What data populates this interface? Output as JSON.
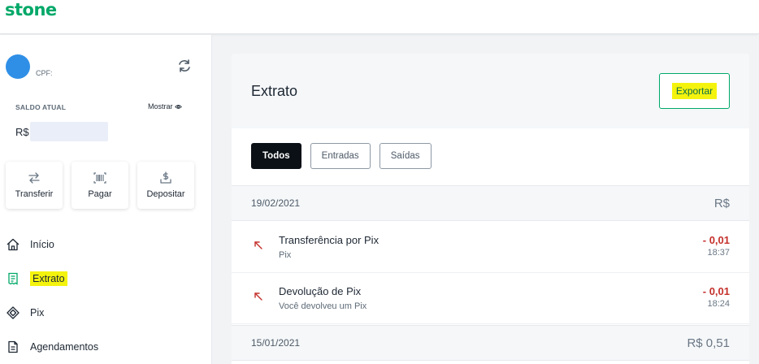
{
  "brand": {
    "logo_text": "stone",
    "color": "#00a868"
  },
  "account": {
    "cpf_label": "CPF:",
    "balance_label": "SALDO ATUAL",
    "show_label": "Mostrar",
    "currency": "R$"
  },
  "quick_actions": [
    {
      "label": "Transferir",
      "icon": "transfer-icon"
    },
    {
      "label": "Pagar",
      "icon": "barcode-icon"
    },
    {
      "label": "Depositar",
      "icon": "deposit-icon"
    }
  ],
  "nav": [
    {
      "label": "Início",
      "icon": "home-icon"
    },
    {
      "label": "Extrato",
      "icon": "statement-icon",
      "active": true
    },
    {
      "label": "Pix",
      "icon": "pix-icon"
    },
    {
      "label": "Agendamentos",
      "icon": "document-icon"
    }
  ],
  "statement": {
    "title": "Extrato",
    "export_label": "Exportar",
    "filters": [
      {
        "label": "Todos",
        "active": true
      },
      {
        "label": "Entradas",
        "active": false
      },
      {
        "label": "Saídas",
        "active": false
      }
    ],
    "groups": [
      {
        "date": "19/02/2021",
        "total": "R$",
        "transactions": [
          {
            "title": "Transferência por Pix",
            "subtitle": "Pix",
            "amount": "- 0,01",
            "time": "18:37"
          },
          {
            "title": "Devolução de Pix",
            "subtitle": "Você devolveu um Pix",
            "amount": "- 0,01",
            "time": "18:24"
          }
        ]
      },
      {
        "date": "15/01/2021",
        "total": "R$ 0,51",
        "transactions": []
      }
    ]
  },
  "colors": {
    "negative": "#c4302b",
    "highlight": "#f4f30e",
    "accent": "#00a868"
  }
}
